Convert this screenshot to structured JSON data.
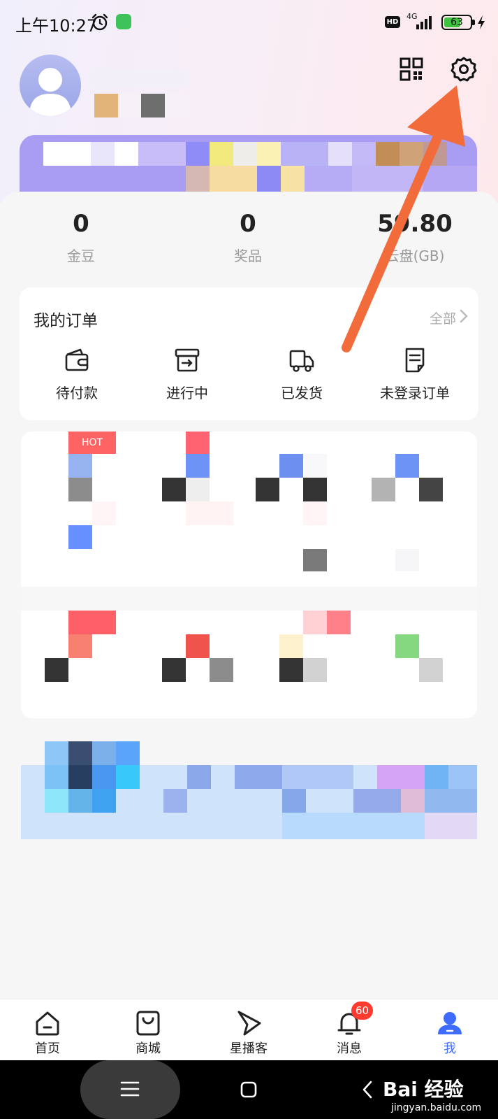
{
  "status_bar": {
    "time": "上午10:27",
    "hd": "HD",
    "network": "4G",
    "battery": "63",
    "battery_level": 0.63
  },
  "header": {
    "qr_icon": "qr-code-icon",
    "settings_icon": "gear-icon"
  },
  "stats": [
    {
      "value": "0",
      "label": "金豆"
    },
    {
      "value": "0",
      "label": "奖品"
    },
    {
      "value": "59.80",
      "label": "云盘(GB)"
    }
  ],
  "orders": {
    "title": "我的订单",
    "all_label": "全部",
    "items": [
      {
        "label": "待付款",
        "icon": "wallet-icon"
      },
      {
        "label": "进行中",
        "icon": "box-icon"
      },
      {
        "label": "已发货",
        "icon": "truck-icon"
      },
      {
        "label": "未登录订单",
        "icon": "document-icon"
      }
    ]
  },
  "grid": {
    "hot_badge": "HOT"
  },
  "bottom_nav": {
    "items": [
      {
        "label": "首页",
        "icon": "home-icon"
      },
      {
        "label": "商城",
        "icon": "shopping-bag-icon"
      },
      {
        "label": "星播客",
        "icon": "play-arrow-icon"
      },
      {
        "label": "消息",
        "icon": "bell-icon"
      },
      {
        "label": "我",
        "icon": "profile-icon"
      }
    ],
    "message_badge": "60",
    "active_color": "#3f6bff"
  },
  "colors": {
    "annotation_arrow": "#f26b3a",
    "badge_red": "#ff3b30"
  },
  "watermark": {
    "brand": "Bai 经验",
    "url": "jingyan.baidu.com"
  }
}
